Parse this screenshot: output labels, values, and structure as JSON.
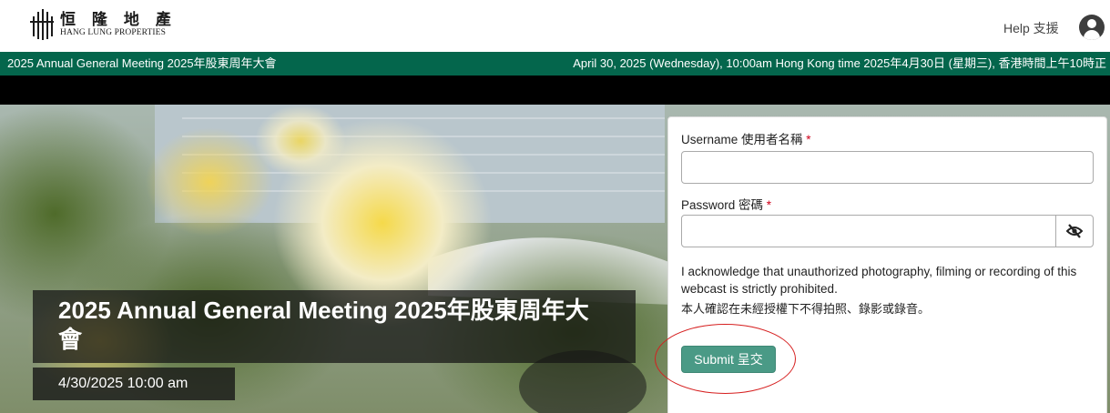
{
  "header": {
    "logo": {
      "cn": "恒 隆 地 產",
      "en": "HANG LUNG PROPERTIES"
    },
    "help_label": "Help 支援",
    "icons": {
      "logo_mark": "hang-lung-logo-mark",
      "user": "user-circle-icon"
    }
  },
  "banner": {
    "left": "2025 Annual General Meeting 2025年股東周年大會",
    "right": "April 30, 2025 (Wednesday), 10:00am Hong Kong time 2025年4月30日 (星期三), 香港時間上午10時正"
  },
  "hero": {
    "title": "2025 Annual General Meeting 2025年股東周年大會",
    "date": "4/30/2025 10:00 am"
  },
  "login": {
    "username_label": "Username 使用者名稱",
    "username_value": "",
    "password_label": "Password 密碼",
    "password_value": "",
    "required_mark": "*",
    "password_toggle_icon": "eye-slash-icon",
    "acknowledge_en": "I acknowledge that unauthorized photography, filming or recording of this webcast is strictly prohibited.",
    "acknowledge_cn": "本人確認在未經授權下不得拍照、錄影或錄音。",
    "submit_label": "Submit 呈交"
  },
  "colors": {
    "brand_green": "#04664c",
    "submit_green": "#4a9a86",
    "annotation_red": "#d61f1f",
    "required_red": "#d0021b"
  }
}
